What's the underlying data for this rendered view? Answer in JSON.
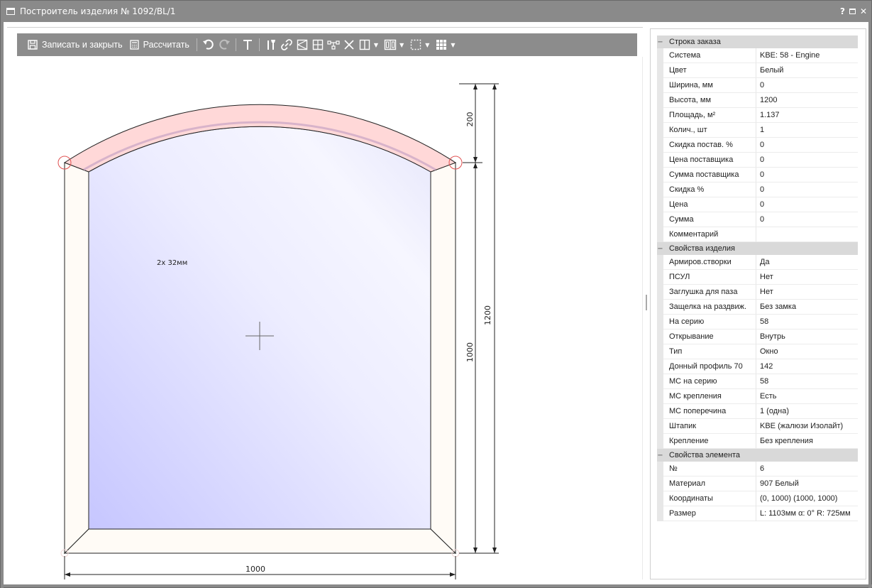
{
  "window": {
    "title": "Построитель изделия № 1092/BL/1",
    "help": "?",
    "close": "✕"
  },
  "toolbar": {
    "save_label": "Записать и закрыть",
    "calc_label": "Рассчитать"
  },
  "drawing": {
    "glass_label": "2х 32мм",
    "dim_width": "1000",
    "dim_arc_height": "200",
    "dim_rect_height": "1000",
    "dim_total_height": "1200"
  },
  "properties": {
    "order": {
      "title": "Строка заказа",
      "rows": [
        {
          "k": "Система",
          "v": "KBE: 58 - Engine"
        },
        {
          "k": "Цвет",
          "v": "Белый"
        },
        {
          "k": "Ширина, мм",
          "v": "0"
        },
        {
          "k": "Высота, мм",
          "v": "1200"
        },
        {
          "k": "Площадь, м²",
          "v": "1.137"
        },
        {
          "k": "Колич., шт",
          "v": "1"
        },
        {
          "k": "Скидка постав. %",
          "v": "0"
        },
        {
          "k": "Цена поставщика",
          "v": "0"
        },
        {
          "k": "Сумма поставщика",
          "v": "0"
        },
        {
          "k": "Скидка %",
          "v": "0"
        },
        {
          "k": "Цена",
          "v": "0"
        },
        {
          "k": "Сумма",
          "v": "0"
        },
        {
          "k": "Комментарий",
          "v": ""
        }
      ]
    },
    "product": {
      "title": "Свойства изделия",
      "rows": [
        {
          "k": "Армиров.створки",
          "v": "Да"
        },
        {
          "k": "ПСУЛ",
          "v": "Нет"
        },
        {
          "k": "Заглушка для паза",
          "v": "Нет"
        },
        {
          "k": "Защелка на раздвиж.",
          "v": "Без замка"
        },
        {
          "k": "На серию",
          "v": "58"
        },
        {
          "k": "Открывание",
          "v": "Внутрь"
        },
        {
          "k": "Тип",
          "v": "Окно"
        },
        {
          "k": "Донный профиль 70",
          "v": "142"
        },
        {
          "k": "МС на серию",
          "v": "58"
        },
        {
          "k": "МС крепления",
          "v": "Есть"
        },
        {
          "k": "МС поперечина",
          "v": "1 (одна)"
        },
        {
          "k": "Штапик",
          "v": "KBE (жалюзи Изолайт)"
        },
        {
          "k": "Крепление",
          "v": "Без крепления"
        }
      ]
    },
    "element": {
      "title": "Свойства элемента",
      "rows": [
        {
          "k": "№",
          "v": "6"
        },
        {
          "k": "Материал",
          "v": "907 Белый"
        },
        {
          "k": "Координаты",
          "v": "(0, 1000) (1000, 1000)"
        },
        {
          "k": "Размер",
          "v": "L: 1103мм  α: 0° R: 725мм"
        }
      ]
    }
  },
  "colors": {
    "titlebar": "#8a8a8a",
    "toolbar": "#8c8c8c",
    "glass_start": "#c8c8ff",
    "glass_end": "#f2f2ff",
    "arc_frame": "#ffd6d6",
    "category_bg": "#d9d9d9"
  }
}
